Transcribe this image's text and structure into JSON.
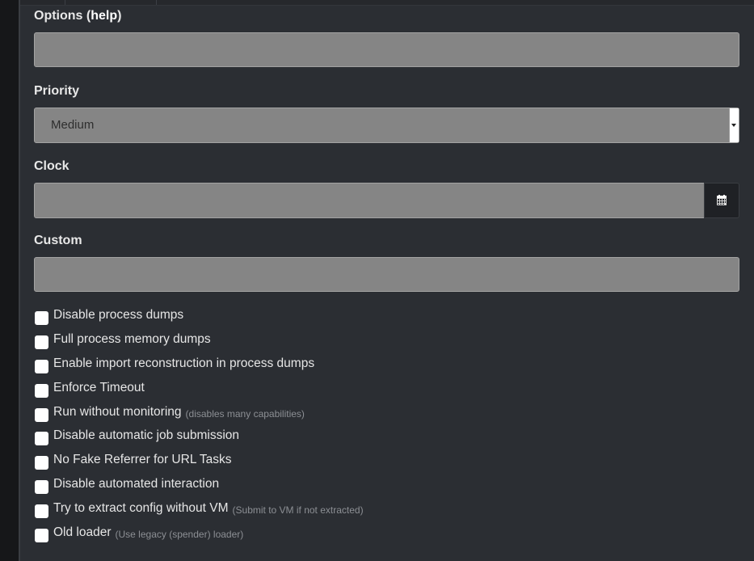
{
  "form": {
    "options_label": "Options (",
    "options_help_link": "help",
    "options_label_close": ")",
    "options_value": "",
    "priority_label": "Priority",
    "priority_selected": "Medium",
    "clock_label": "Clock",
    "clock_value": "",
    "custom_label": "Custom",
    "custom_value": ""
  },
  "checkboxes": [
    {
      "label": "Disable process dumps",
      "hint": "",
      "checked": false
    },
    {
      "label": "Full process memory dumps",
      "hint": "",
      "checked": false
    },
    {
      "label": "Enable import reconstruction in process dumps",
      "hint": "",
      "checked": false
    },
    {
      "label": "Enforce Timeout",
      "hint": "",
      "checked": false
    },
    {
      "label": "Run without monitoring",
      "hint": "(disables many capabilities)",
      "checked": false
    },
    {
      "label": "Disable automatic job submission",
      "hint": "",
      "checked": false
    },
    {
      "label": "No Fake Referrer for URL Tasks",
      "hint": "",
      "checked": false
    },
    {
      "label": "Disable automated interaction",
      "hint": "",
      "checked": false
    },
    {
      "label": "Try to extract config without VM",
      "hint": "(Submit to VM if not extracted)",
      "checked": false
    },
    {
      "label": "Old loader",
      "hint": "(Use legacy (spender) loader)",
      "checked": false
    }
  ],
  "icons": {
    "calendar": "calendar-icon",
    "select_arrow": "chevron-down-icon"
  },
  "colors": {
    "panel_bg": "#2b2e33",
    "input_bg": "#858585",
    "label_text": "#e8e8e8",
    "hint_text": "#8c8f94"
  }
}
